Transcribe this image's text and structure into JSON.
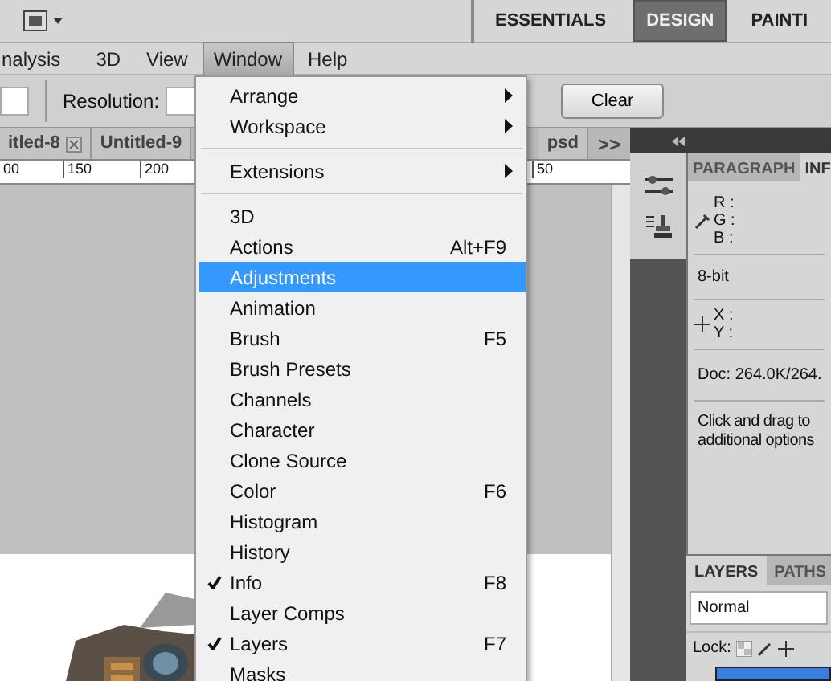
{
  "workspace_bar": {
    "workspaces": [
      {
        "label": "ESSENTIALS",
        "selected": false
      },
      {
        "label": "DESIGN",
        "selected": true
      },
      {
        "label": "PAINTI",
        "selected": false
      }
    ]
  },
  "menu_bar": [
    {
      "label": "nalysis",
      "open": false
    },
    {
      "label": "3D",
      "open": false
    },
    {
      "label": "View",
      "open": false
    },
    {
      "label": "Window",
      "open": true
    },
    {
      "label": "Help",
      "open": false
    }
  ],
  "options_bar": {
    "resolution_label": "Resolution:",
    "clear_button": "Clear"
  },
  "document_tabs": [
    {
      "label": "itled-8",
      "closable": true
    },
    {
      "label": "Untitled-9",
      "closable": false
    },
    {
      "label": "psd",
      "closable": false
    }
  ],
  "tabs_overflow": ">>",
  "ruler_labels": [
    "00",
    "150",
    "200",
    "50"
  ],
  "window_menu": [
    {
      "kind": "item",
      "label": "Arrange",
      "submenu": true,
      "checked": false,
      "selected": false
    },
    {
      "kind": "item",
      "label": "Workspace",
      "submenu": true,
      "checked": false,
      "selected": false
    },
    {
      "kind": "separator"
    },
    {
      "kind": "item",
      "label": "Extensions",
      "submenu": true,
      "checked": false,
      "selected": false
    },
    {
      "kind": "separator"
    },
    {
      "kind": "item",
      "label": "3D",
      "submenu": false,
      "checked": false,
      "selected": false
    },
    {
      "kind": "item",
      "label": "Actions",
      "shortcut": "Alt+F9",
      "submenu": false,
      "checked": false,
      "selected": false
    },
    {
      "kind": "item",
      "label": "Adjustments",
      "submenu": false,
      "checked": false,
      "selected": true
    },
    {
      "kind": "item",
      "label": "Animation",
      "submenu": false,
      "checked": false,
      "selected": false
    },
    {
      "kind": "item",
      "label": "Brush",
      "shortcut": "F5",
      "submenu": false,
      "checked": false,
      "selected": false
    },
    {
      "kind": "item",
      "label": "Brush Presets",
      "submenu": false,
      "checked": false,
      "selected": false
    },
    {
      "kind": "item",
      "label": "Channels",
      "submenu": false,
      "checked": false,
      "selected": false
    },
    {
      "kind": "item",
      "label": "Character",
      "submenu": false,
      "checked": false,
      "selected": false
    },
    {
      "kind": "item",
      "label": "Clone Source",
      "submenu": false,
      "checked": false,
      "selected": false
    },
    {
      "kind": "item",
      "label": "Color",
      "shortcut": "F6",
      "submenu": false,
      "checked": false,
      "selected": false
    },
    {
      "kind": "item",
      "label": "Histogram",
      "submenu": false,
      "checked": false,
      "selected": false
    },
    {
      "kind": "item",
      "label": "History",
      "submenu": false,
      "checked": false,
      "selected": false
    },
    {
      "kind": "item",
      "label": "Info",
      "shortcut": "F8",
      "submenu": false,
      "checked": true,
      "selected": false
    },
    {
      "kind": "item",
      "label": "Layer Comps",
      "submenu": false,
      "checked": false,
      "selected": false
    },
    {
      "kind": "item",
      "label": "Layers",
      "shortcut": "F7",
      "submenu": false,
      "checked": true,
      "selected": false
    },
    {
      "kind": "item",
      "label": "Masks",
      "submenu": false,
      "checked": false,
      "selected": false
    }
  ],
  "info_panel": {
    "tabs": [
      {
        "label": "PARAGRAPH",
        "selected": false
      },
      {
        "label": "INF",
        "selected": true
      }
    ],
    "color_readouts": [
      "R :",
      "G :",
      "B :"
    ],
    "bit_depth": "8-bit",
    "position_readouts": [
      "X :",
      "Y :"
    ],
    "doc_size": "Doc: 264.0K/264.",
    "hint_lines": [
      "Click and drag to",
      "additional options"
    ]
  },
  "layers_panel": {
    "tabs": [
      {
        "label": "LAYERS",
        "selected": true
      },
      {
        "label": "PATHS",
        "selected": false
      }
    ],
    "blend_mode": "Normal",
    "lock_label": "Lock:"
  }
}
